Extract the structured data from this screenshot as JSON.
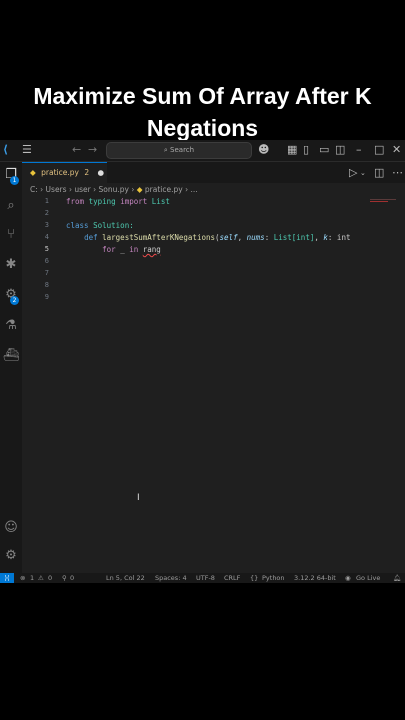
{
  "overlay_title": "Maximize Sum Of Array After K Negations",
  "search": {
    "label": "Search"
  },
  "tab": {
    "filename": "pratice.py",
    "problems": "2"
  },
  "breadcrumb": {
    "c": "C:",
    "users": "Users",
    "user": "user",
    "sonu": "Sonu.py",
    "file": "pratice.py",
    "more": "..."
  },
  "badges": {
    "explorer": "1",
    "extensions": "2"
  },
  "lines": [
    {
      "n": "1"
    },
    {
      "n": "2"
    },
    {
      "n": "3"
    },
    {
      "n": "4"
    },
    {
      "n": "5"
    },
    {
      "n": "6"
    },
    {
      "n": "7"
    },
    {
      "n": "8"
    },
    {
      "n": "9"
    }
  ],
  "code": {
    "l1_from": "from",
    "l1_mod": "typing",
    "l1_import": "import",
    "l1_name": "List",
    "l3_class": "class",
    "l3_name": "Solution:",
    "l4_def": "def",
    "l4_fn": "largestSumAfterKNegations",
    "l4_open": "(",
    "l4_self": "self",
    "l4_c1": ", ",
    "l4_nums": "nums",
    "l4_c2": ": ",
    "l4_list": "List",
    "l4_int": "[int]",
    "l4_c3": ", ",
    "l4_k": "k",
    "l4_c4": ": int",
    "l5_for": "for",
    "l5_var": "_",
    "l5_in": "in",
    "l5_rang": "rang"
  },
  "status": {
    "errors": "1",
    "warnings": "0",
    "position": "Ln 5, Col 22",
    "spaces": "Spaces: 4",
    "encoding": "UTF-8",
    "eol": "CRLF",
    "language": "Python",
    "interpreter": "3.12.2 64-bit",
    "golive": "Go Live"
  }
}
